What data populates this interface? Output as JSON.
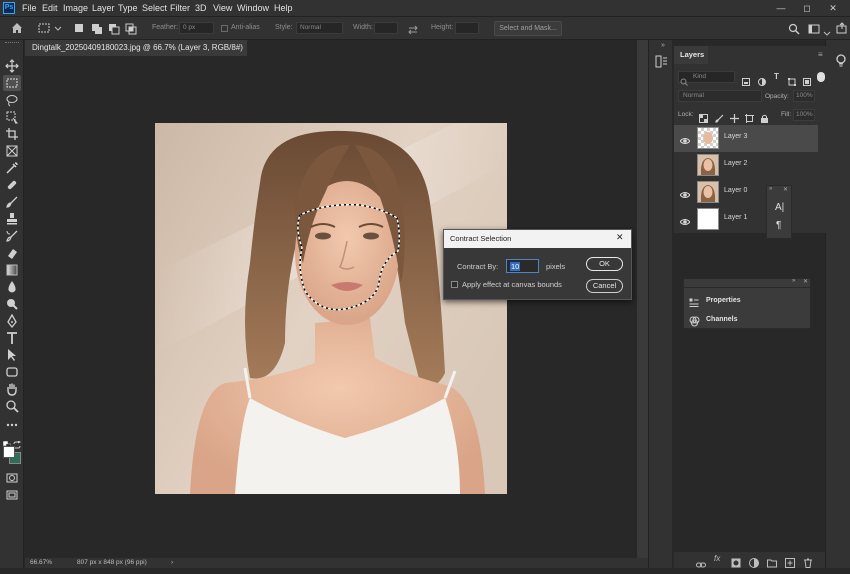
{
  "menubar": {
    "logo": "Ps",
    "items": [
      "File",
      "Edit",
      "Image",
      "Layer",
      "Type",
      "Select",
      "Filter",
      "3D",
      "View",
      "Window",
      "Help"
    ],
    "window_controls": [
      "—",
      "◻",
      "✕"
    ]
  },
  "options": {
    "feather_label": "Feather:",
    "feather_value": "0 px",
    "antialias_label": "Anti-alias",
    "style_label": "Style:",
    "style_value": "Normal",
    "width_label": "Width:",
    "height_label": "Height:",
    "select_mask_label": "Select and Mask..."
  },
  "document": {
    "tab_title": "Dingtalk_20250409180023.jpg @ 66.7% (Layer 3, RGB/8#) *",
    "tab_close": "×",
    "zoom": "66.67%",
    "dimensions": "807 px x 848 px (96 ppi)",
    "status_arrow": "›"
  },
  "layers_panel": {
    "title": "Layers",
    "kind_label": "Kind",
    "blend_mode": "Normal",
    "opacity_label": "Opacity:",
    "opacity_value": "100%",
    "lock_label": "Lock:",
    "fill_label": "Fill:",
    "fill_value": "100%",
    "layers": [
      {
        "name": "Layer 3",
        "visible": true,
        "selected": true
      },
      {
        "name": "Layer 2",
        "visible": false,
        "selected": false
      },
      {
        "name": "Layer 0",
        "visible": true,
        "selected": false
      },
      {
        "name": "Layer 1",
        "visible": true,
        "selected": false
      }
    ]
  },
  "mini_panel": {
    "char_icon": "A|",
    "para_icon": "¶"
  },
  "dialog": {
    "title": "Contract Selection",
    "close": "✕",
    "contract_label": "Contract By:",
    "contract_value": "10",
    "unit": "pixels",
    "checkbox_label": "Apply effect at canvas bounds",
    "checkbox_checked": false,
    "ok_label": "OK",
    "cancel_label": "Cancel"
  },
  "side_panels": {
    "properties_label": "Properties",
    "channels_label": "Channels"
  }
}
